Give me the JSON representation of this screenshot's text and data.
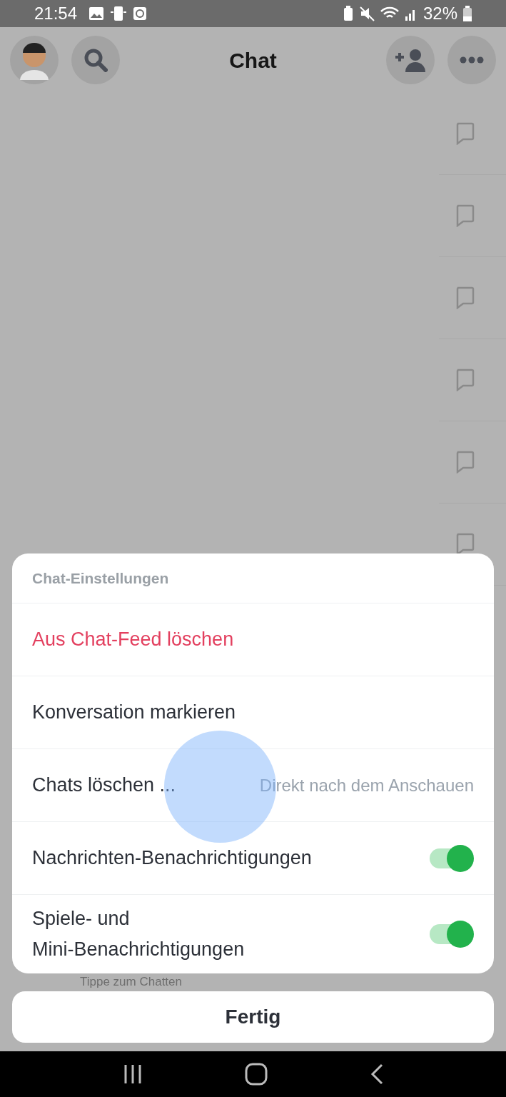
{
  "status_bar": {
    "time": "21:54",
    "battery": "32%"
  },
  "header": {
    "title": "Chat"
  },
  "background": {
    "hint": "Tippe zum Chatten"
  },
  "sheet": {
    "title": "Chat-Einstellungen",
    "items": [
      {
        "kind": "action",
        "label": "Aus Chat-Feed löschen",
        "danger": true
      },
      {
        "kind": "action",
        "label": "Konversation markieren",
        "danger": false
      },
      {
        "kind": "value",
        "label": "Chats löschen ...",
        "value": "Direkt nach dem Anschauen"
      },
      {
        "kind": "toggle",
        "label": "Nachrichten-Benachrichtigungen",
        "on": true
      },
      {
        "kind": "toggle",
        "label": "Spiele- und\nMini-Benachrichtigungen",
        "on": true
      }
    ]
  },
  "done_button": "Fertig"
}
